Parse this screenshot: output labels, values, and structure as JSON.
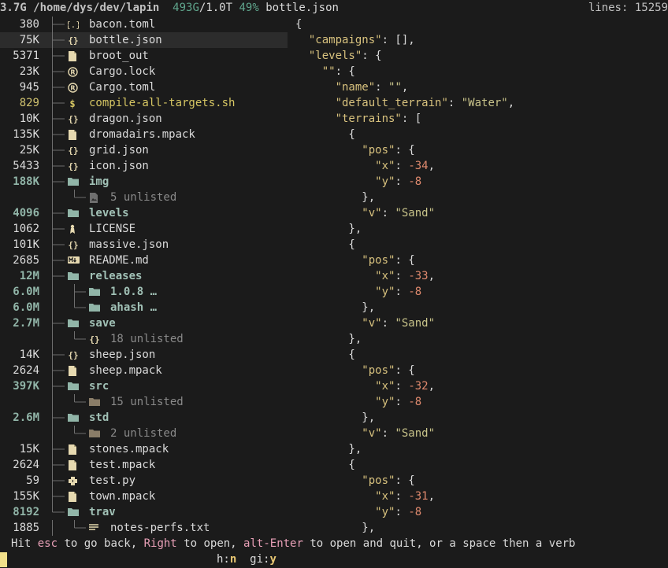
{
  "header": {
    "root_size": "3.7G",
    "path": "/home/dys/dev/lapin",
    "disk_used": "493G",
    "disk_total": "1.0T",
    "disk_percent": "49%",
    "selected_file": "bottle.json",
    "lines_label": "lines:",
    "lines_value": "15259"
  },
  "tree": [
    {
      "size": "380",
      "icon": "toml",
      "name": "bacon.toml",
      "kind": "file",
      "depth": 0
    },
    {
      "size": "75K",
      "icon": "json",
      "name": "bottle.json",
      "kind": "file",
      "depth": 0,
      "selected": true
    },
    {
      "size": "5371",
      "icon": "file",
      "name": "broot_out",
      "kind": "file",
      "depth": 0
    },
    {
      "size": "23K",
      "icon": "rust",
      "name": "Cargo.lock",
      "kind": "file",
      "depth": 0
    },
    {
      "size": "945",
      "icon": "rust",
      "name": "Cargo.toml",
      "kind": "file",
      "depth": 0
    },
    {
      "size": "829",
      "icon": "shell",
      "name": "compile-all-targets.sh",
      "kind": "exe",
      "depth": 0
    },
    {
      "size": "10K",
      "icon": "json",
      "name": "dragon.json",
      "kind": "file",
      "depth": 0
    },
    {
      "size": "135K",
      "icon": "file",
      "name": "dromadairs.mpack",
      "kind": "file",
      "depth": 0
    },
    {
      "size": "25K",
      "icon": "json",
      "name": "grid.json",
      "kind": "file",
      "depth": 0
    },
    {
      "size": "5433",
      "icon": "json",
      "name": "icon.json",
      "kind": "file",
      "depth": 0
    },
    {
      "size": "188K",
      "icon": "folder",
      "name": "img",
      "kind": "dir",
      "depth": 0
    },
    {
      "size": "",
      "icon": "image",
      "name": "5 unlisted",
      "kind": "unlisted",
      "depth": 1
    },
    {
      "size": "4096",
      "icon": "folder",
      "name": "levels",
      "kind": "dir",
      "depth": 0
    },
    {
      "size": "1062",
      "icon": "license",
      "name": "LICENSE",
      "kind": "file",
      "depth": 0
    },
    {
      "size": "101K",
      "icon": "json",
      "name": "massive.json",
      "kind": "file",
      "depth": 0
    },
    {
      "size": "2685",
      "icon": "markdown",
      "name": "README.md",
      "kind": "file",
      "depth": 0
    },
    {
      "size": "12M",
      "icon": "folder",
      "name": "releases",
      "kind": "dir",
      "depth": 0
    },
    {
      "size": "6.0M",
      "icon": "folder",
      "name": "1.0.8 …",
      "kind": "dir",
      "depth": 1
    },
    {
      "size": "6.0M",
      "icon": "folder",
      "name": "ahash …",
      "kind": "dir",
      "depth": 1
    },
    {
      "size": "2.7M",
      "icon": "folder",
      "name": "save",
      "kind": "dir",
      "depth": 0
    },
    {
      "size": "",
      "icon": "json",
      "name": "18 unlisted",
      "kind": "unlisted",
      "depth": 1
    },
    {
      "size": "14K",
      "icon": "json",
      "name": "sheep.json",
      "kind": "file",
      "depth": 0
    },
    {
      "size": "2624",
      "icon": "file",
      "name": "sheep.mpack",
      "kind": "file",
      "depth": 0
    },
    {
      "size": "397K",
      "icon": "folder",
      "name": "src",
      "kind": "dir",
      "depth": 0
    },
    {
      "size": "",
      "icon": "folder-dim",
      "name": "15 unlisted",
      "kind": "unlisted",
      "depth": 1
    },
    {
      "size": "2.6M",
      "icon": "folder",
      "name": "std",
      "kind": "dir",
      "depth": 0
    },
    {
      "size": "",
      "icon": "folder-dim",
      "name": "2 unlisted",
      "kind": "unlisted",
      "depth": 1
    },
    {
      "size": "15K",
      "icon": "file",
      "name": "stones.mpack",
      "kind": "file",
      "depth": 0
    },
    {
      "size": "2624",
      "icon": "file",
      "name": "test.mpack",
      "kind": "file",
      "depth": 0
    },
    {
      "size": "59",
      "icon": "python",
      "name": "test.py",
      "kind": "file",
      "depth": 0
    },
    {
      "size": "155K",
      "icon": "file",
      "name": "town.mpack",
      "kind": "file",
      "depth": 0
    },
    {
      "size": "8192",
      "icon": "folder",
      "name": "trav",
      "kind": "dir",
      "depth": 0
    },
    {
      "size": "1885",
      "icon": "text",
      "name": "notes-perfs.txt",
      "kind": "file",
      "depth": 1
    }
  ],
  "preview": [
    [
      {
        "t": "{",
        "c": ""
      }
    ],
    [
      {
        "t": "  ",
        "c": ""
      },
      {
        "t": "\"campaigns\"",
        "c": "k"
      },
      {
        "t": ": [],",
        "c": ""
      }
    ],
    [
      {
        "t": "  ",
        "c": ""
      },
      {
        "t": "\"levels\"",
        "c": "k"
      },
      {
        "t": ": {",
        "c": ""
      }
    ],
    [
      {
        "t": "    ",
        "c": ""
      },
      {
        "t": "\"\"",
        "c": "k"
      },
      {
        "t": ": {",
        "c": ""
      }
    ],
    [
      {
        "t": "      ",
        "c": ""
      },
      {
        "t": "\"name\"",
        "c": "k"
      },
      {
        "t": ": ",
        "c": ""
      },
      {
        "t": "\"\"",
        "c": "s"
      },
      {
        "t": ",",
        "c": ""
      }
    ],
    [
      {
        "t": "      ",
        "c": ""
      },
      {
        "t": "\"default_terrain\"",
        "c": "k"
      },
      {
        "t": ": ",
        "c": ""
      },
      {
        "t": "\"Water\"",
        "c": "s"
      },
      {
        "t": ",",
        "c": ""
      }
    ],
    [
      {
        "t": "      ",
        "c": ""
      },
      {
        "t": "\"terrains\"",
        "c": "k"
      },
      {
        "t": ": [",
        "c": ""
      }
    ],
    [
      {
        "t": "        {",
        "c": ""
      }
    ],
    [
      {
        "t": "          ",
        "c": ""
      },
      {
        "t": "\"pos\"",
        "c": "k"
      },
      {
        "t": ": {",
        "c": ""
      }
    ],
    [
      {
        "t": "            ",
        "c": ""
      },
      {
        "t": "\"x\"",
        "c": "k"
      },
      {
        "t": ": ",
        "c": ""
      },
      {
        "t": "-34",
        "c": "n"
      },
      {
        "t": ",",
        "c": ""
      }
    ],
    [
      {
        "t": "            ",
        "c": ""
      },
      {
        "t": "\"y\"",
        "c": "k"
      },
      {
        "t": ": ",
        "c": ""
      },
      {
        "t": "-8",
        "c": "n"
      }
    ],
    [
      {
        "t": "          },",
        "c": ""
      }
    ],
    [
      {
        "t": "          ",
        "c": ""
      },
      {
        "t": "\"v\"",
        "c": "k"
      },
      {
        "t": ": ",
        "c": ""
      },
      {
        "t": "\"Sand\"",
        "c": "s"
      }
    ],
    [
      {
        "t": "        },",
        "c": ""
      }
    ],
    [
      {
        "t": "        {",
        "c": ""
      }
    ],
    [
      {
        "t": "          ",
        "c": ""
      },
      {
        "t": "\"pos\"",
        "c": "k"
      },
      {
        "t": ": {",
        "c": ""
      }
    ],
    [
      {
        "t": "            ",
        "c": ""
      },
      {
        "t": "\"x\"",
        "c": "k"
      },
      {
        "t": ": ",
        "c": ""
      },
      {
        "t": "-33",
        "c": "n"
      },
      {
        "t": ",",
        "c": ""
      }
    ],
    [
      {
        "t": "            ",
        "c": ""
      },
      {
        "t": "\"y\"",
        "c": "k"
      },
      {
        "t": ": ",
        "c": ""
      },
      {
        "t": "-8",
        "c": "n"
      }
    ],
    [
      {
        "t": "          },",
        "c": ""
      }
    ],
    [
      {
        "t": "          ",
        "c": ""
      },
      {
        "t": "\"v\"",
        "c": "k"
      },
      {
        "t": ": ",
        "c": ""
      },
      {
        "t": "\"Sand\"",
        "c": "s"
      }
    ],
    [
      {
        "t": "        },",
        "c": ""
      }
    ],
    [
      {
        "t": "        {",
        "c": ""
      }
    ],
    [
      {
        "t": "          ",
        "c": ""
      },
      {
        "t": "\"pos\"",
        "c": "k"
      },
      {
        "t": ": {",
        "c": ""
      }
    ],
    [
      {
        "t": "            ",
        "c": ""
      },
      {
        "t": "\"x\"",
        "c": "k"
      },
      {
        "t": ": ",
        "c": ""
      },
      {
        "t": "-32",
        "c": "n"
      },
      {
        "t": ",",
        "c": ""
      }
    ],
    [
      {
        "t": "            ",
        "c": ""
      },
      {
        "t": "\"y\"",
        "c": "k"
      },
      {
        "t": ": ",
        "c": ""
      },
      {
        "t": "-8",
        "c": "n"
      }
    ],
    [
      {
        "t": "          },",
        "c": ""
      }
    ],
    [
      {
        "t": "          ",
        "c": ""
      },
      {
        "t": "\"v\"",
        "c": "k"
      },
      {
        "t": ": ",
        "c": ""
      },
      {
        "t": "\"Sand\"",
        "c": "s"
      }
    ],
    [
      {
        "t": "        },",
        "c": ""
      }
    ],
    [
      {
        "t": "        {",
        "c": ""
      }
    ],
    [
      {
        "t": "          ",
        "c": ""
      },
      {
        "t": "\"pos\"",
        "c": "k"
      },
      {
        "t": ": {",
        "c": ""
      }
    ],
    [
      {
        "t": "            ",
        "c": ""
      },
      {
        "t": "\"x\"",
        "c": "k"
      },
      {
        "t": ": ",
        "c": ""
      },
      {
        "t": "-31",
        "c": "n"
      },
      {
        "t": ",",
        "c": ""
      }
    ],
    [
      {
        "t": "            ",
        "c": ""
      },
      {
        "t": "\"y\"",
        "c": "k"
      },
      {
        "t": ": ",
        "c": ""
      },
      {
        "t": "-8",
        "c": "n"
      }
    ],
    [
      {
        "t": "          },",
        "c": ""
      }
    ]
  ],
  "status": {
    "hit": "Hit ",
    "esc": "esc",
    "to_go_back": " to go back, ",
    "right": "Right",
    "to_open": " to open, ",
    "alt_enter": "alt-Enter",
    "rest": " to open and quit, or a space then a verb"
  },
  "keys": {
    "h_label": "h:",
    "h_value": "n",
    "gi_label": "gi:",
    "gi_value": "y"
  },
  "colors": {
    "background": "#1b1b1b",
    "directory": "#a1c1b6",
    "executable": "#d6c663",
    "json_key": "#d8c27e",
    "json_number": "#e08a6e",
    "status_keyword": "#e8a0b7",
    "cursor": "#f2e08a"
  }
}
